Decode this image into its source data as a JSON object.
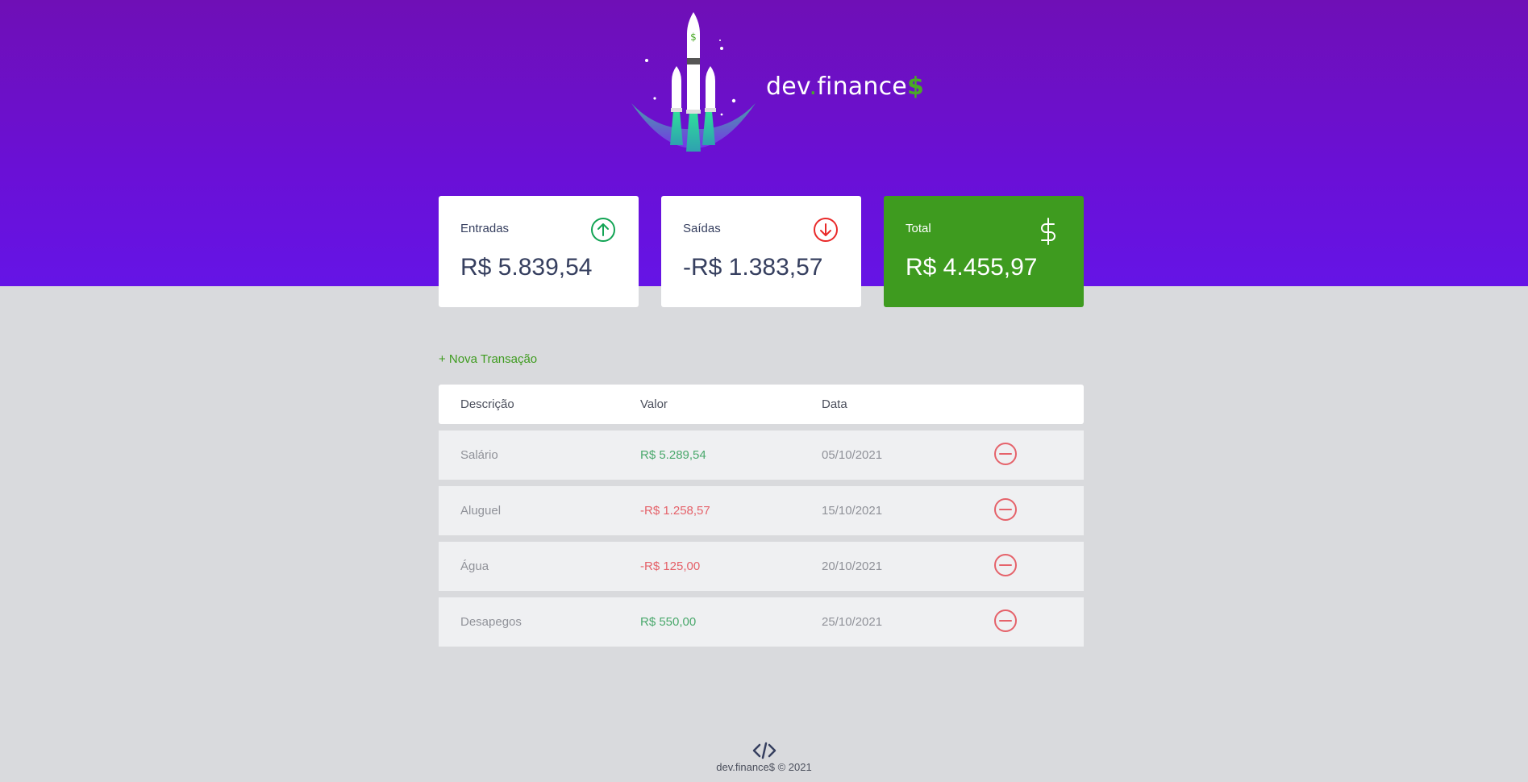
{
  "brand": {
    "prefix": "dev",
    "dot": ".",
    "name": "finance",
    "symbol": "$"
  },
  "colors": {
    "header": "#6a10d6",
    "accent": "#49aa26",
    "income": "#4aa86c",
    "expense": "#e5626a"
  },
  "cards": {
    "income": {
      "label": "Entradas",
      "value": "R$ 5.839,54",
      "icon": "arrow-up-circle-icon"
    },
    "expense": {
      "label": "Saídas",
      "value": "-R$ 1.383,57",
      "icon": "arrow-down-circle-icon"
    },
    "total": {
      "label": "Total",
      "value": "R$ 4.455,97",
      "icon": "dollar-icon"
    }
  },
  "new_transaction_label": "+ Nova Transação",
  "table": {
    "headers": [
      "Descrição",
      "Valor",
      "Data"
    ],
    "rows": [
      {
        "description": "Salário",
        "amount": "R$ 5.289,54",
        "date": "05/10/2021",
        "type": "income"
      },
      {
        "description": "Aluguel",
        "amount": "-R$ 1.258,57",
        "date": "15/10/2021",
        "type": "expense"
      },
      {
        "description": "Água",
        "amount": "-R$ 125,00",
        "date": "20/10/2021",
        "type": "expense"
      },
      {
        "description": "Desapegos",
        "amount": "R$ 550,00",
        "date": "25/10/2021",
        "type": "income"
      }
    ]
  },
  "footer": {
    "icon": "code-icon",
    "text": "dev.finance$ © 2021"
  }
}
